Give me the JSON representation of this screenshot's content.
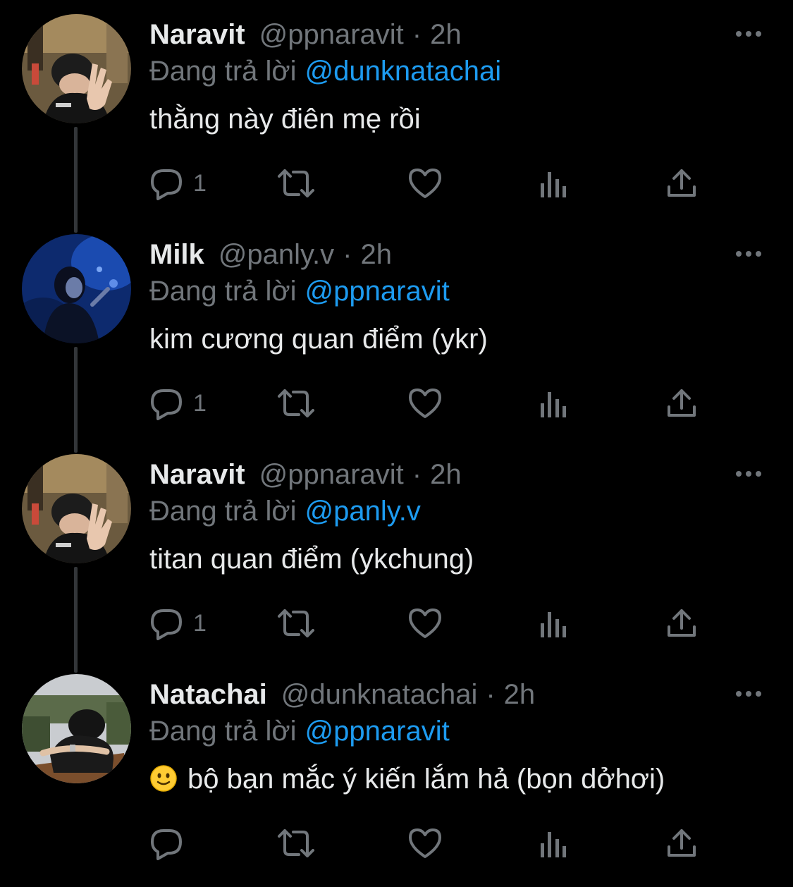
{
  "colors": {
    "background": "#000000",
    "text_primary": "#e7e9ea",
    "text_secondary": "#71767b",
    "mention": "#1d9bf0",
    "thread_line": "#333639"
  },
  "icons": {
    "reply": "reply-icon",
    "retweet": "retweet-icon",
    "like": "heart-icon",
    "views": "views-icon",
    "share": "share-icon",
    "more": "more-dots-icon"
  },
  "tweets": [
    {
      "name": "Naravit",
      "handle": "@ppnaravit",
      "separator": "·",
      "time": "2h",
      "reply_prefix": "Đang trả lời",
      "reply_to": "@dunknatachai",
      "text": "thằng này điên mẹ rồi",
      "emoji": "",
      "reply_count": "1"
    },
    {
      "name": "Milk",
      "handle": "@panly.v",
      "separator": "·",
      "time": "2h",
      "reply_prefix": "Đang trả lời",
      "reply_to": "@ppnaravit",
      "text": "kim cương quan điểm (ykr)",
      "emoji": "",
      "reply_count": "1"
    },
    {
      "name": "Naravit",
      "handle": "@ppnaravit",
      "separator": "·",
      "time": "2h",
      "reply_prefix": "Đang trả lời",
      "reply_to": "@panly.v",
      "text": "titan quan điểm (ykchung)",
      "emoji": "",
      "reply_count": "1"
    },
    {
      "name": "Natachai",
      "handle": "@dunknatachai",
      "separator": "·",
      "time": "2h",
      "reply_prefix": "Đang trả lời",
      "reply_to": "@ppnaravit",
      "text": "bộ bạn mắc ý kiến lắm hả (bọn dởhơi)",
      "emoji": "slightly-smiling-face",
      "reply_count": ""
    }
  ]
}
